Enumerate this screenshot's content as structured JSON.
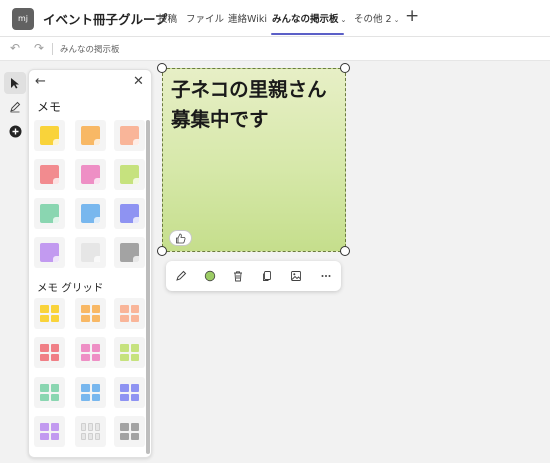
{
  "header": {
    "avatar_text": "mj",
    "team_name": "イベント冊子グループ",
    "tabs": [
      {
        "label": "投稿"
      },
      {
        "label": "ファイル"
      },
      {
        "label": "連絡Wiki"
      },
      {
        "label": "みんなの掲示板"
      },
      {
        "label": "その他 2"
      }
    ],
    "accent_color": "#5b5fc7"
  },
  "subbar": {
    "title": "みんなの掲示板",
    "undo_icon": "undo-icon",
    "redo_icon": "redo-icon"
  },
  "rail": {
    "tools": [
      "select-arrow-icon",
      "pen-icon",
      "add-icon"
    ]
  },
  "panel": {
    "section_memo": "メモ",
    "section_memo_grid": "メモ グリッド",
    "memo_colors": [
      "#f9d33a",
      "#f8b865",
      "#f9b599",
      "#f28b8f",
      "#ee8fc5",
      "#c6e27e",
      "#8ad6b1",
      "#78b7ee",
      "#8e93f2",
      "#c29af0",
      "#e6e6e6",
      "#a3a3a3"
    ],
    "grid_colors": [
      "#f9d33a",
      "#f8b865",
      "#f9b599",
      "#f07f86",
      "#ee8fc5",
      "#c6e27e",
      "#8ad6b1",
      "#78b7ee",
      "#8e93f2",
      "#c29af0",
      "#e6e6e6",
      "#a3a3a3"
    ]
  },
  "sticky": {
    "text": "子ネコの里親さん\n募集中です",
    "color": "#d6e8a9"
  },
  "float_toolbar": {
    "buttons": [
      "pen-icon",
      "color-dot-icon",
      "delete-icon",
      "copy-icon",
      "image-icon",
      "more-icon"
    ],
    "dot_color": "#9ccc65"
  }
}
